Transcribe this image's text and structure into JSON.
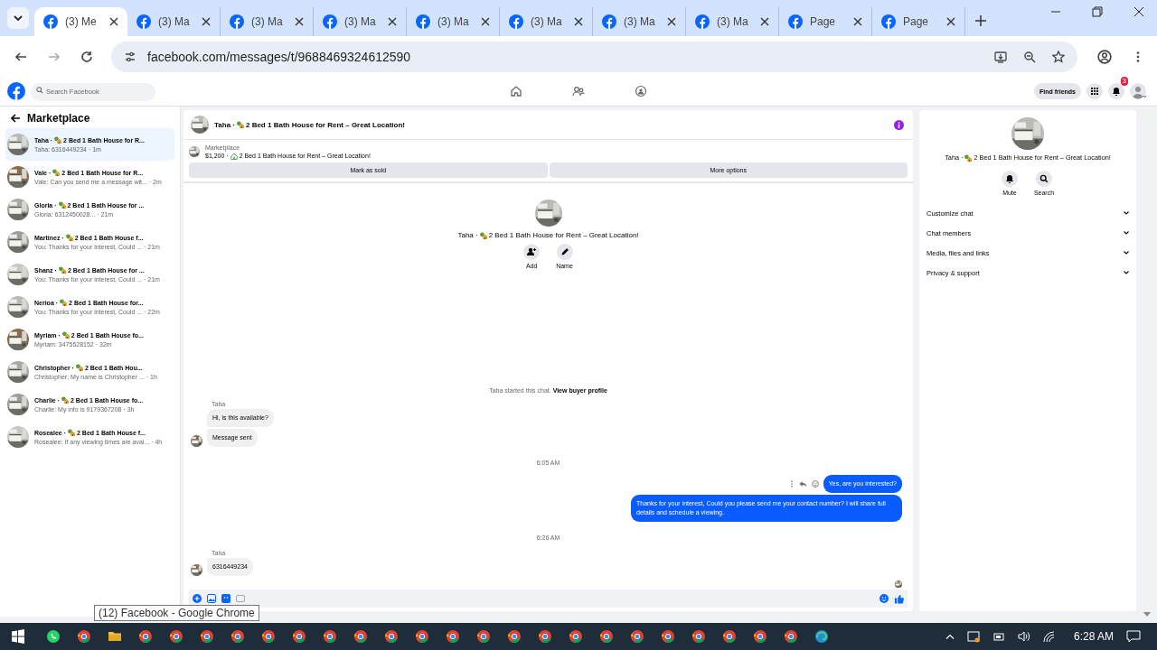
{
  "browser": {
    "tabs": [
      {
        "title": "(3) Me",
        "selected": true
      },
      {
        "title": "(3) Ma",
        "selected": false
      },
      {
        "title": "(3) Ma",
        "selected": false
      },
      {
        "title": "(3) Ma",
        "selected": false
      },
      {
        "title": "(3) Ma",
        "selected": false
      },
      {
        "title": "(3) Ma",
        "selected": false
      },
      {
        "title": "(3) Ma",
        "selected": false
      },
      {
        "title": "(3) Ma",
        "selected": false
      },
      {
        "title": "Page",
        "selected": false
      },
      {
        "title": "Page",
        "selected": false
      }
    ],
    "url": "facebook.com/messages/t/9688469324612590"
  },
  "facebook_nav": {
    "search_placeholder": "Search Facebook",
    "find_friends": "Find friends",
    "notification_count": "3"
  },
  "sidebar": {
    "title": "Marketplace",
    "conversations": [
      {
        "name": "Taha ·",
        "listing": "2 Bed 1 Bath House for R...",
        "preview": "Taha: 6316449234 · 1m",
        "selected": true
      },
      {
        "name": "Vale ·",
        "listing": "2 Bed 1 Bath House for R...",
        "preview": "Vale: Can you send me a message wit... · 2m",
        "selected": false
      },
      {
        "name": "Gloria ·",
        "listing": "2 Bed 1 Bath House for ...",
        "preview": "Gloria: 6312450028... · 21m",
        "selected": false
      },
      {
        "name": "Martinez ·",
        "listing": "2 Bed 1 Bath House f...",
        "preview": "You: Thanks for your interest, Could ... · 21m",
        "selected": false
      },
      {
        "name": "Shanz ·",
        "listing": "2 Bed 1 Bath House for ...",
        "preview": "You: Thanks for your interest, Could ... · 21m",
        "selected": false
      },
      {
        "name": "Nerioa ·",
        "listing": "2 Bed 1 Bath House for...",
        "preview": "You: Thanks for your interest, Could ... · 22m",
        "selected": false
      },
      {
        "name": "Myriam ·",
        "listing": "2 Bed 1 Bath House fo...",
        "preview": "Myriam: 3475528152 · 32m",
        "selected": false
      },
      {
        "name": "Christopher ·",
        "listing": "2 Bed 1 Bath Hou...",
        "preview": "Christopher: My name is Christopher ... · 1h",
        "selected": false
      },
      {
        "name": "Charlie ·",
        "listing": "2 Bed 1 Bath House fo...",
        "preview": "Charlie: My info is 9179367208 · 3h",
        "selected": false
      },
      {
        "name": "Rosealee ·",
        "listing": "2 Bed 1 Bath House f...",
        "preview": "Rosealee: If any viewing times are avai... · 4h",
        "selected": false
      }
    ]
  },
  "chat": {
    "header": {
      "name": "Taha ·",
      "listing": "2 Bed 1 Bath House for Rent – Great Location!"
    },
    "listing_bar": {
      "label": "Marketplace",
      "price": "$1,200 ·",
      "listing": "2 Bed 1 Bath House for Rent – Great Location!"
    },
    "buttons": [
      "Mark as sold",
      "More options"
    ],
    "intro": {
      "name": "Taha ·",
      "listing": "2 Bed 1 Bath House for Rent – Great Location!",
      "actions": [
        {
          "kind": "add",
          "label": "Add"
        },
        {
          "kind": "name",
          "label": "Name"
        }
      ]
    },
    "started": {
      "text": "Taha started this chat.",
      "link": "View buyer profile"
    },
    "messages": [
      {
        "kind": "sender",
        "text": "Taha"
      },
      {
        "kind": "incoming",
        "text": "Hi, is this available?",
        "avatar": false
      },
      {
        "kind": "incoming",
        "text": "Message sent",
        "avatar": true
      },
      {
        "kind": "time",
        "text": "6:05 AM"
      },
      {
        "kind": "outgoing_hovered",
        "text": "Yes, are you interested?"
      },
      {
        "kind": "outgoing",
        "text": "Thanks for your interest, Could you please send me your contact number? I will share full details and schedule a viewing."
      },
      {
        "kind": "time",
        "text": "6:26 AM"
      },
      {
        "kind": "sender",
        "text": "Taha"
      },
      {
        "kind": "incoming",
        "text": "6316449234",
        "avatar": true
      },
      {
        "kind": "seen"
      }
    ]
  },
  "details": {
    "name": "Taha ·",
    "listing": "2 Bed 1 Bath House for Rent – Great Location!",
    "actions": [
      {
        "kind": "mute",
        "label": "Mute"
      },
      {
        "kind": "search",
        "label": "Search"
      }
    ],
    "sections": [
      "Customize chat",
      "Chat members",
      "Media, files and links",
      "Privacy & support"
    ]
  },
  "tooltip": "(12) Facebook - Google Chrome",
  "taskbar": {
    "time": "6:28 AM"
  }
}
